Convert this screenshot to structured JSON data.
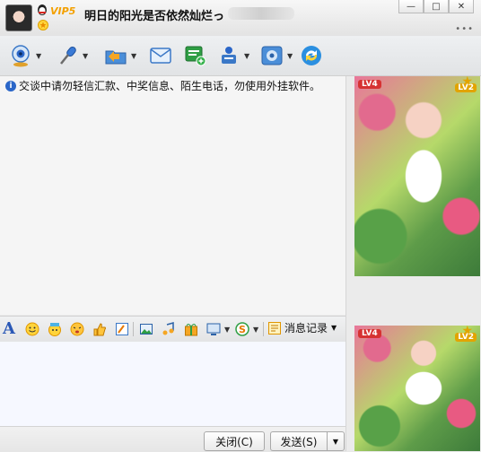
{
  "title": {
    "vip_label": "VIP5",
    "nickname": "明日的阳光是否依然灿烂っ"
  },
  "window": {
    "minimize_glyph": "—",
    "maximize_glyph": "□",
    "close_glyph": "✕",
    "more_glyph": "•••"
  },
  "toolbar": {
    "dropdown_glyph": "▼",
    "icons": [
      "video-call-icon",
      "voice-call-icon",
      "file-transfer-icon",
      "mail-icon",
      "sms-icon",
      "group-chat-icon",
      "app-settings-icon",
      "refresh-icon"
    ]
  },
  "chat": {
    "notice": "交谈中请勿轻信汇款、中奖信息、陌生电话，勿使用外挂软件。"
  },
  "sidebar": {
    "lv4": "LV4",
    "lv2": "LV2"
  },
  "format_bar": {
    "font_letter": "A",
    "history_label": "消息记录"
  },
  "buttons": {
    "close_label": "关闭(C)",
    "send_label": "发送(S)"
  },
  "colors": {
    "accent": "#2a66c8",
    "vip": "#f3a000"
  }
}
